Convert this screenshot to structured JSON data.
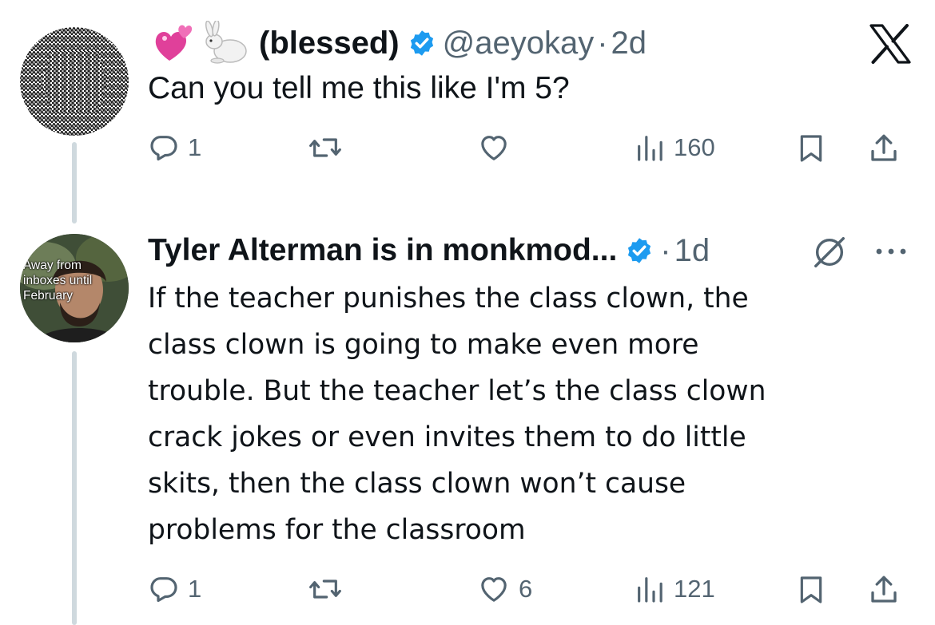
{
  "tweets": [
    {
      "display_name": "(blessed)",
      "handle": "@aeyokay",
      "dot": "·",
      "time": "2d",
      "text": "Can you tell me this like I'm 5?",
      "name_emojis": [
        "sparkling-heart-icon",
        "rabbit-icon"
      ],
      "actions": {
        "replies": "1",
        "reposts": "",
        "likes": "",
        "views": "160"
      }
    },
    {
      "display_name": "Tyler Alterman is in monkmod...",
      "handle": "",
      "dot": "·",
      "time": "1d",
      "text_lines": [
        "If the teacher punishes the class clown, the",
        "class clown is going to make even more",
        "trouble. But the teacher let’s the class clown",
        "crack jokes or even invites them to do little",
        "skits, then the class clown won’t cause",
        "problems for the classroom"
      ],
      "avatar_overlay": [
        "Away from",
        "inboxes until",
        "February"
      ],
      "actions": {
        "replies": "1",
        "reposts": "",
        "likes": "6",
        "views": "121"
      }
    }
  ],
  "colors": {
    "verified": "#1d9bf0",
    "muted": "#536471",
    "thread_line": "#cfd9de",
    "heart_emoji": "#e0409a"
  }
}
